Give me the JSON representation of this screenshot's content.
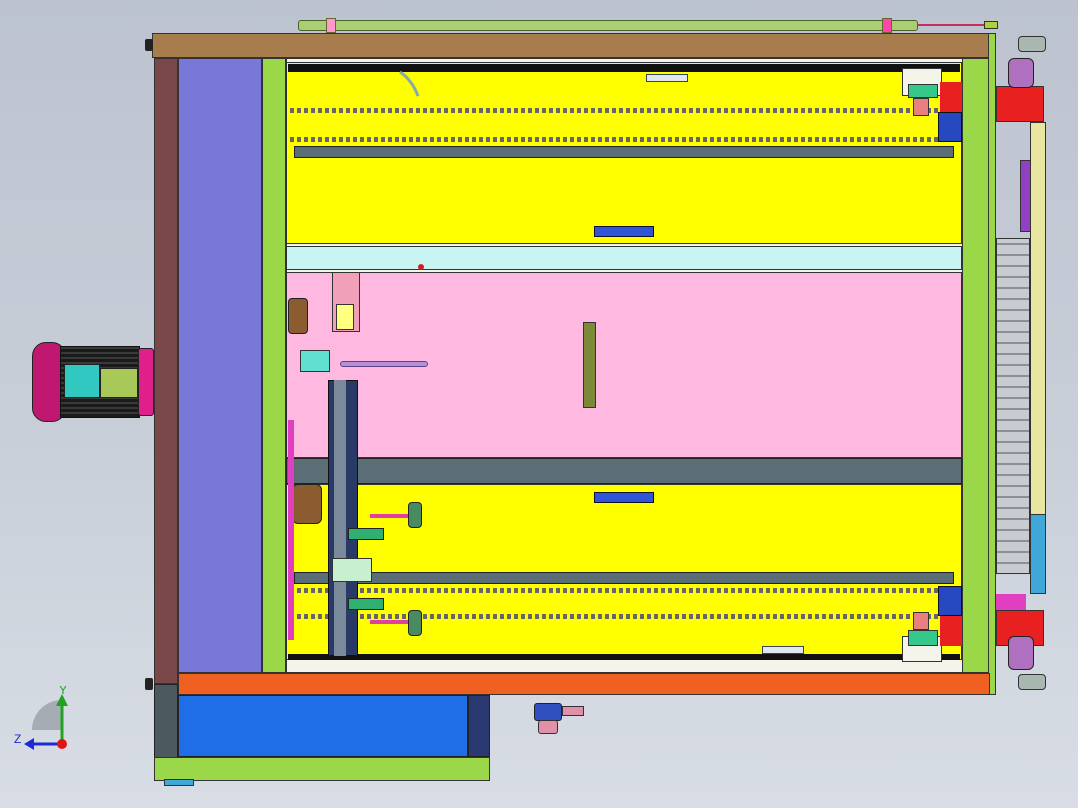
{
  "view": {
    "model": "cad-assembly-top-view",
    "background_colors": [
      "#bcc3cf",
      "#d8dde5"
    ]
  },
  "triad": {
    "axis_y_label": "Y",
    "axis_z_label": "Z",
    "y_color": "#21a321",
    "z_color": "#1c2bd6",
    "origin_color": "#e01414"
  },
  "colors": {
    "frame_wood": "#a77d4e",
    "frame_green": "#9ad84a",
    "yellow_panel": "#ffff00",
    "pink_panel": "#ffb8e0",
    "cyan_rail": "#c8f4f4",
    "steel_beam": "#5c6e75",
    "purple_panel": "#7878d8",
    "orange_rail": "#f06020",
    "blue_box": "#1f6ee8",
    "motor_magenta": "#e0208a",
    "red_block": "#e82020"
  }
}
